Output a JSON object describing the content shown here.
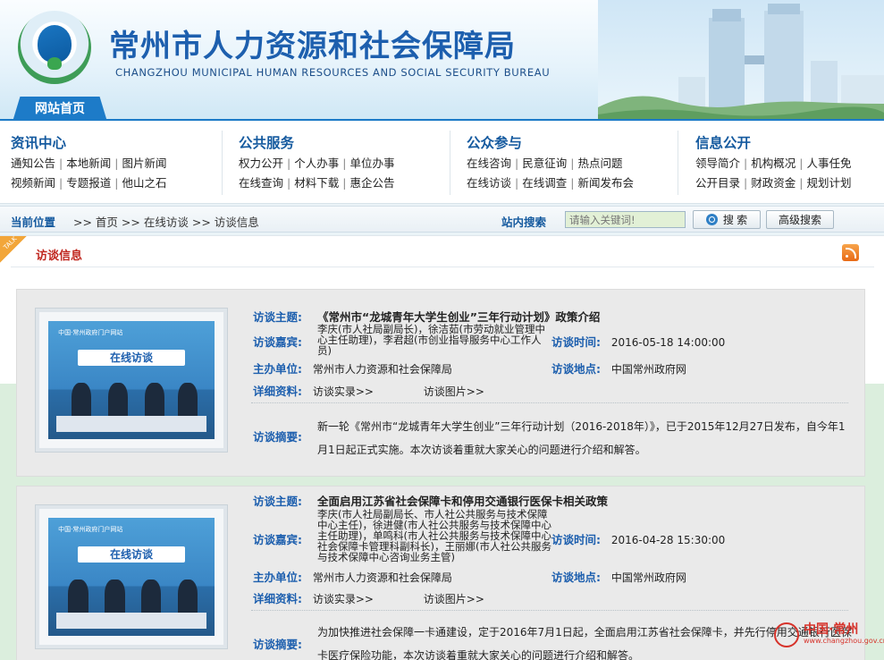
{
  "header": {
    "title": "常州市人力资源和社会保障局",
    "subtitle": "CHANGZHOU MUNICIPAL HUMAN RESOURCES AND SOCIAL SECURITY BUREAU",
    "home_tab": "网站首页",
    "brand_color": "#1d5fae"
  },
  "nav": {
    "columns": [
      {
        "title": "资讯中心",
        "rows": [
          [
            "通知公告",
            "本地新闻",
            "图片新闻"
          ],
          [
            "视频新闻",
            "专题报道",
            "他山之石"
          ]
        ]
      },
      {
        "title": "公共服务",
        "rows": [
          [
            "权力公开",
            "个人办事",
            "单位办事"
          ],
          [
            "在线查询",
            "材料下载",
            "惠企公告"
          ]
        ]
      },
      {
        "title": "公众参与",
        "rows": [
          [
            "在线咨询",
            "民意征询",
            "热点问题"
          ],
          [
            "在线访谈",
            "在线调查",
            "新闻发布会"
          ]
        ]
      },
      {
        "title": "信息公开",
        "rows": [
          [
            "领导简介",
            "机构概况",
            "人事任免"
          ],
          [
            "公开目录",
            "财政资金",
            "规划计划"
          ]
        ]
      }
    ]
  },
  "locbar": {
    "label": "当前位置",
    "crumbs": [
      "首页",
      "在线访谈",
      "访谈信息"
    ],
    "search_label": "站内搜索",
    "search_placeholder": "请输入关键词!",
    "search_button": "搜 索",
    "advanced_button": "高级搜索"
  },
  "section": {
    "corner": "TALK",
    "title": "访谈信息"
  },
  "labels": {
    "topic": "访谈主题:",
    "guests": "访谈嘉宾:",
    "time": "访谈时间:",
    "organizer": "主办单位:",
    "place": "访谈地点:",
    "details": "详细资料:",
    "summary": "访谈摘要:"
  },
  "interviews": [
    {
      "thumb_caption": "中国·常州政府门户网站",
      "thumb_banner": "在线访谈",
      "topic": "《常州市“龙城青年大学生创业”三年行动计划》政策介绍",
      "guests": "李庆(市人社局副局长)，徐洁茹(市劳动就业管理中心主任助理)，李君超(市创业指导服务中心工作人员)",
      "time": "2016-05-18 14:00:00",
      "organizer": "常州市人力资源和社会保障局",
      "place": "中国常州政府网",
      "link_record": "访谈实录>>",
      "link_photos": "访谈图片>>",
      "summary": "新一轮《常州市“龙城青年大学生创业”三年行动计划（2016-2018年）》，已于2015年12月27日发布，自今年1月1日起正式实施。本次访谈着重就大家关心的问题进行介绍和解答。"
    },
    {
      "thumb_caption": "中国·常州政府门户网站",
      "thumb_banner": "在线访谈",
      "topic": "全面启用江苏省社会保障卡和停用交通银行医保卡相关政策",
      "guests": "李庆(市人社局副局长、市人社公共服务与技术保障中心主任)，徐进健(市人社公共服务与技术保障中心主任助理)，单鸣科(市人社公共服务与技术保障中心社会保障卡管理科副科长)，王丽娜(市人社公共服务与技术保障中心咨询业务主管)",
      "time": "2016-04-28 15:30:00",
      "organizer": "常州市人力资源和社会保障局",
      "place": "中国常州政府网",
      "link_record": "访谈实录>>",
      "link_photos": "访谈图片>>",
      "summary": "为加快推进社会保障一卡通建设，定于2016年7月1日起，全面启用江苏省社会保障卡，并先行停用交通银行医保卡医疗保险功能，本次访谈着重就大家关心的问题进行介绍和解答。"
    }
  ],
  "watermark": {
    "text": "中国·常州",
    "url": "www.changzhou.gov.cn"
  }
}
